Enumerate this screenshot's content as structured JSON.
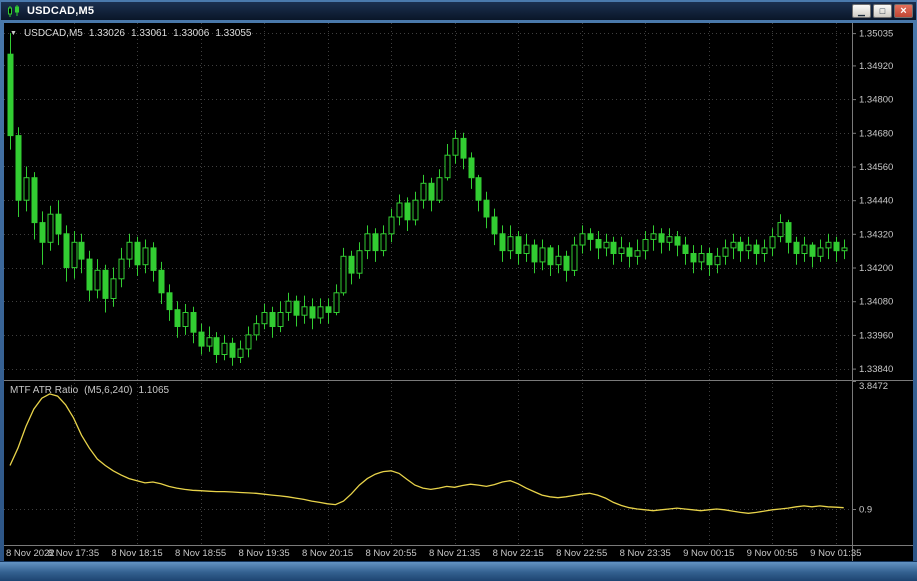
{
  "window": {
    "title": "USDCAD,M5"
  },
  "titlebar": {
    "minimize_glyph": "▁",
    "restore_glyph": "□",
    "close_glyph": "×"
  },
  "chart_header": {
    "arrow": "▼",
    "symbol": "USDCAD,M5",
    "open": "1.33026",
    "high": "1.33061",
    "low": "1.33006",
    "close": "1.33055"
  },
  "indicator_header": {
    "name": "MTF ATR Ratio",
    "params": "(M5,6,240)",
    "value": "1.1065"
  },
  "price_axis": {
    "min": 1.33803,
    "max": 1.35071,
    "labels": [
      "1.35035",
      "1.34920",
      "1.34800",
      "1.34680",
      "1.34560",
      "1.34440",
      "1.34320",
      "1.34200",
      "1.34080",
      "1.33960",
      "1.33840"
    ]
  },
  "indicator_axis": {
    "min": 0.07,
    "max": 3.8472,
    "level_line": 0.9,
    "labels": [
      {
        "text": "3.8472",
        "value": 3.8472
      },
      {
        "text": "0.9",
        "value": 0.9
      }
    ]
  },
  "time_axis": {
    "first_label": "8 Nov 2022",
    "grid_step_candles": 8,
    "labels": [
      "8 Nov 17:35",
      "8 Nov 18:15",
      "8 Nov 18:55",
      "8 Nov 19:35",
      "8 Nov 20:15",
      "8 Nov 20:55",
      "8 Nov 21:35",
      "8 Nov 22:15",
      "8 Nov 22:55",
      "8 Nov 23:35",
      "9 Nov 00:15",
      "9 Nov 00:55",
      "9 Nov 01:35"
    ]
  },
  "colors": {
    "chart_bg": "#000000",
    "grid": "#3f3f3f",
    "candle_green": "#32CD32",
    "bull_fill": "#000000",
    "indicator_line": "#E8D34A",
    "separator": "#7a7a7a",
    "axis_text": "#c8c8c8"
  },
  "chart_data": {
    "type": "candlestick",
    "symbol": "USDCAD",
    "timeframe": "M5",
    "price_max_visible": 1.35035,
    "price_min_visible": 1.3384,
    "candles": [
      [
        1.3496,
        1.35035,
        1.3462,
        1.3467
      ],
      [
        1.3467,
        1.347,
        1.3438,
        1.3444
      ],
      [
        1.3444,
        1.3456,
        1.344,
        1.3452
      ],
      [
        1.3452,
        1.3454,
        1.343,
        1.3436
      ],
      [
        1.3436,
        1.344,
        1.3421,
        1.3429
      ],
      [
        1.3429,
        1.3442,
        1.3426,
        1.3439
      ],
      [
        1.3439,
        1.3444,
        1.3428,
        1.3432
      ],
      [
        1.3432,
        1.3435,
        1.3415,
        1.342
      ],
      [
        1.342,
        1.3433,
        1.3416,
        1.3429
      ],
      [
        1.3429,
        1.3432,
        1.3418,
        1.3423
      ],
      [
        1.3423,
        1.3426,
        1.3408,
        1.3412
      ],
      [
        1.3412,
        1.3423,
        1.3409,
        1.3419
      ],
      [
        1.3419,
        1.3421,
        1.3404,
        1.3409
      ],
      [
        1.3409,
        1.342,
        1.3406,
        1.3416
      ],
      [
        1.3416,
        1.3427,
        1.3413,
        1.3423
      ],
      [
        1.3423,
        1.3432,
        1.342,
        1.3429
      ],
      [
        1.3429,
        1.3431,
        1.3417,
        1.3421
      ],
      [
        1.3421,
        1.343,
        1.3418,
        1.3427
      ],
      [
        1.3427,
        1.3429,
        1.3415,
        1.3419
      ],
      [
        1.3419,
        1.3422,
        1.3407,
        1.3411
      ],
      [
        1.3411,
        1.3414,
        1.3401,
        1.3405
      ],
      [
        1.3405,
        1.3408,
        1.3395,
        1.3399
      ],
      [
        1.3399,
        1.3407,
        1.3396,
        1.3404
      ],
      [
        1.3404,
        1.3406,
        1.3393,
        1.3397
      ],
      [
        1.3397,
        1.34,
        1.3389,
        1.3392
      ],
      [
        1.3392,
        1.3399,
        1.339,
        1.3395
      ],
      [
        1.3395,
        1.3397,
        1.3386,
        1.3389
      ],
      [
        1.3389,
        1.3396,
        1.3387,
        1.3393
      ],
      [
        1.3393,
        1.3395,
        1.3385,
        1.3388
      ],
      [
        1.3388,
        1.3394,
        1.3386,
        1.3391
      ],
      [
        1.3391,
        1.3399,
        1.3388,
        1.3396
      ],
      [
        1.3396,
        1.3403,
        1.3394,
        1.34
      ],
      [
        1.34,
        1.3407,
        1.3398,
        1.3404
      ],
      [
        1.3404,
        1.3406,
        1.3395,
        1.3399
      ],
      [
        1.3399,
        1.3408,
        1.3397,
        1.3404
      ],
      [
        1.3404,
        1.3411,
        1.3401,
        1.3408
      ],
      [
        1.3408,
        1.341,
        1.3399,
        1.3403
      ],
      [
        1.3403,
        1.341,
        1.34,
        1.3406
      ],
      [
        1.3406,
        1.3409,
        1.3398,
        1.3402
      ],
      [
        1.3402,
        1.3409,
        1.34,
        1.3406
      ],
      [
        1.3406,
        1.3409,
        1.34,
        1.3404
      ],
      [
        1.3404,
        1.3414,
        1.3403,
        1.3411
      ],
      [
        1.3411,
        1.3427,
        1.341,
        1.3424
      ],
      [
        1.3424,
        1.3426,
        1.3414,
        1.3418
      ],
      [
        1.3418,
        1.3429,
        1.3416,
        1.3426
      ],
      [
        1.3426,
        1.3435,
        1.3423,
        1.3432
      ],
      [
        1.3432,
        1.3434,
        1.3422,
        1.3426
      ],
      [
        1.3426,
        1.3435,
        1.3424,
        1.3432
      ],
      [
        1.3432,
        1.3441,
        1.3429,
        1.3438
      ],
      [
        1.3438,
        1.3446,
        1.3435,
        1.3443
      ],
      [
        1.3443,
        1.3445,
        1.3433,
        1.3437
      ],
      [
        1.3437,
        1.3447,
        1.3435,
        1.3444
      ],
      [
        1.3444,
        1.3453,
        1.3441,
        1.345
      ],
      [
        1.345,
        1.3452,
        1.344,
        1.3444
      ],
      [
        1.3444,
        1.3455,
        1.3443,
        1.3452
      ],
      [
        1.3452,
        1.3464,
        1.3451,
        1.346
      ],
      [
        1.346,
        1.3469,
        1.3457,
        1.3466
      ],
      [
        1.3466,
        1.3468,
        1.3455,
        1.3459
      ],
      [
        1.3459,
        1.3461,
        1.3448,
        1.3452
      ],
      [
        1.3452,
        1.3453,
        1.344,
        1.3444
      ],
      [
        1.3444,
        1.3447,
        1.3434,
        1.3438
      ],
      [
        1.3438,
        1.3441,
        1.3428,
        1.3432
      ],
      [
        1.3432,
        1.3435,
        1.3422,
        1.3426
      ],
      [
        1.3426,
        1.3435,
        1.3423,
        1.3431
      ],
      [
        1.3431,
        1.3433,
        1.3421,
        1.3425
      ],
      [
        1.3425,
        1.3432,
        1.3422,
        1.3428
      ],
      [
        1.3428,
        1.343,
        1.3418,
        1.3422
      ],
      [
        1.3422,
        1.343,
        1.3419,
        1.3427
      ],
      [
        1.3427,
        1.3428,
        1.3417,
        1.3421
      ],
      [
        1.3421,
        1.3428,
        1.3418,
        1.3424
      ],
      [
        1.3424,
        1.3426,
        1.3415,
        1.3419
      ],
      [
        1.3419,
        1.3431,
        1.3417,
        1.3428
      ],
      [
        1.3428,
        1.3435,
        1.3425,
        1.3432
      ],
      [
        1.3432,
        1.3434,
        1.3426,
        1.343
      ],
      [
        1.343,
        1.3433,
        1.3423,
        1.3427
      ],
      [
        1.3427,
        1.3432,
        1.3424,
        1.3429
      ],
      [
        1.3429,
        1.3431,
        1.3421,
        1.3425
      ],
      [
        1.3425,
        1.3431,
        1.3422,
        1.3427
      ],
      [
        1.3427,
        1.3429,
        1.342,
        1.3424
      ],
      [
        1.3424,
        1.343,
        1.3421,
        1.3426
      ],
      [
        1.3426,
        1.3433,
        1.3423,
        1.343
      ],
      [
        1.343,
        1.3435,
        1.3426,
        1.3432
      ],
      [
        1.3432,
        1.3434,
        1.3425,
        1.3429
      ],
      [
        1.3429,
        1.3434,
        1.3426,
        1.3431
      ],
      [
        1.3431,
        1.3433,
        1.3424,
        1.3428
      ],
      [
        1.3428,
        1.3431,
        1.3421,
        1.3425
      ],
      [
        1.3425,
        1.3428,
        1.3418,
        1.3422
      ],
      [
        1.3422,
        1.3428,
        1.3419,
        1.3425
      ],
      [
        1.3425,
        1.3427,
        1.3417,
        1.3421
      ],
      [
        1.3421,
        1.3427,
        1.3418,
        1.3424
      ],
      [
        1.3424,
        1.343,
        1.3421,
        1.3427
      ],
      [
        1.3427,
        1.3432,
        1.3423,
        1.3429
      ],
      [
        1.3429,
        1.3431,
        1.3422,
        1.3426
      ],
      [
        1.3426,
        1.3431,
        1.3423,
        1.3428
      ],
      [
        1.3428,
        1.343,
        1.3421,
        1.3425
      ],
      [
        1.3425,
        1.343,
        1.3422,
        1.3427
      ],
      [
        1.3427,
        1.3434,
        1.3424,
        1.3431
      ],
      [
        1.3431,
        1.3439,
        1.3429,
        1.3436
      ],
      [
        1.3436,
        1.3437,
        1.3425,
        1.3429
      ],
      [
        1.3429,
        1.3431,
        1.3421,
        1.3425
      ],
      [
        1.3425,
        1.3431,
        1.3422,
        1.3428
      ],
      [
        1.3428,
        1.3429,
        1.342,
        1.3424
      ],
      [
        1.3424,
        1.343,
        1.3422,
        1.3427
      ],
      [
        1.3427,
        1.3432,
        1.3423,
        1.3429
      ],
      [
        1.3429,
        1.3431,
        1.3422,
        1.3426
      ],
      [
        1.3426,
        1.343,
        1.3423,
        1.3427
      ]
    ],
    "indicator": {
      "name": "MTF ATR Ratio",
      "params": "M5,6,240",
      "current_value": 1.1065,
      "values": [
        1.9,
        2.3,
        2.8,
        3.2,
        3.45,
        3.55,
        3.5,
        3.3,
        3.0,
        2.6,
        2.3,
        2.05,
        1.9,
        1.78,
        1.68,
        1.6,
        1.55,
        1.5,
        1.52,
        1.48,
        1.42,
        1.38,
        1.35,
        1.33,
        1.32,
        1.31,
        1.3,
        1.3,
        1.29,
        1.28,
        1.27,
        1.26,
        1.24,
        1.22,
        1.2,
        1.18,
        1.15,
        1.12,
        1.08,
        1.05,
        1.02,
        1.0,
        1.08,
        1.25,
        1.45,
        1.6,
        1.7,
        1.76,
        1.78,
        1.72,
        1.58,
        1.45,
        1.38,
        1.35,
        1.38,
        1.42,
        1.4,
        1.44,
        1.47,
        1.45,
        1.42,
        1.46,
        1.52,
        1.55,
        1.48,
        1.38,
        1.3,
        1.22,
        1.18,
        1.16,
        1.18,
        1.21,
        1.24,
        1.26,
        1.22,
        1.15,
        1.05,
        0.98,
        0.93,
        0.9,
        0.88,
        0.86,
        0.88,
        0.9,
        0.92,
        0.9,
        0.88,
        0.86,
        0.88,
        0.9,
        0.88,
        0.85,
        0.82,
        0.8,
        0.82,
        0.85,
        0.88,
        0.9,
        0.92,
        0.95,
        0.97,
        0.95,
        0.97,
        0.95,
        0.94,
        0.93
      ]
    }
  }
}
